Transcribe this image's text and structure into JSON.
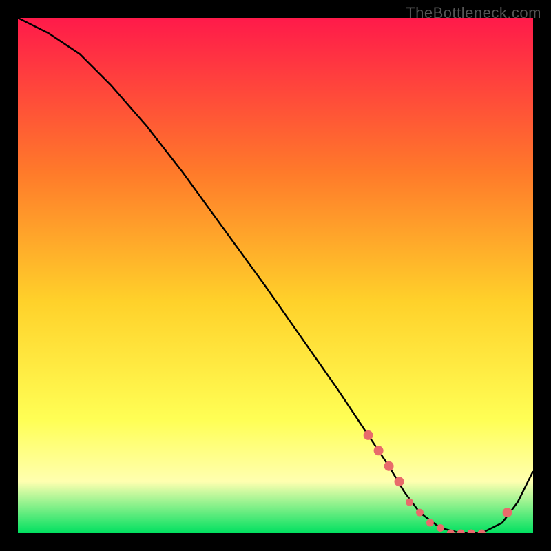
{
  "watermark": "TheBottleneck.com",
  "colors": {
    "bg": "#000000",
    "grad_top": "#ff1a4a",
    "grad_mid1": "#ff7a2a",
    "grad_mid2": "#ffd12a",
    "grad_mid3": "#ffff55",
    "grad_bot_y": "#ffffb0",
    "grad_green": "#00e060",
    "line": "#000000",
    "marker": "#e86b6b"
  },
  "chart_data": {
    "type": "line",
    "title": "",
    "xlabel": "",
    "ylabel": "",
    "xlim": [
      0,
      100
    ],
    "ylim": [
      0,
      100
    ],
    "series": [
      {
        "name": "curve",
        "x": [
          0,
          6,
          12,
          18,
          25,
          32,
          40,
          48,
          55,
          62,
          68,
          72,
          75,
          78,
          82,
          86,
          90,
          94,
          97,
          100
        ],
        "y": [
          100,
          97,
          93,
          87,
          79,
          70,
          59,
          48,
          38,
          28,
          19,
          13,
          8,
          4,
          1,
          0,
          0,
          2,
          6,
          12
        ]
      }
    ],
    "markers": {
      "name": "highlight-points",
      "x": [
        68,
        70,
        72,
        74,
        76,
        78,
        80,
        82,
        84,
        86,
        88,
        90,
        95
      ],
      "y": [
        19,
        16,
        13,
        10,
        6,
        4,
        2,
        1,
        0,
        0,
        0,
        0,
        4
      ]
    }
  }
}
